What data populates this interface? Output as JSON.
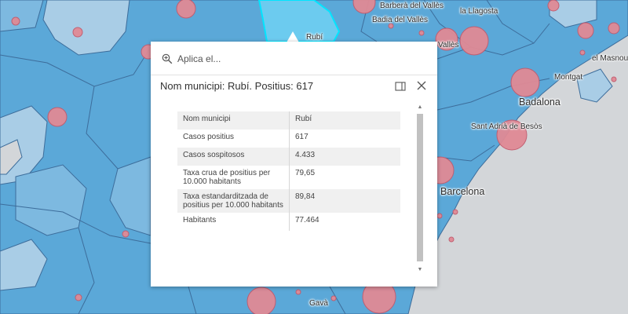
{
  "map": {
    "labels": [
      {
        "text": "Barberà del Vallès",
        "kind": "small"
      },
      {
        "text": "la Llagosta",
        "kind": "small"
      },
      {
        "text": "Badia del Vallès",
        "kind": "small"
      },
      {
        "text": "Rubí",
        "kind": "small"
      },
      {
        "text": "Vallès",
        "kind": "small"
      },
      {
        "text": "el Masnou",
        "kind": "small"
      },
      {
        "text": "Montgat",
        "kind": "small"
      },
      {
        "text": "Badalona",
        "kind": "big"
      },
      {
        "text": "Sant Adrià de Besòs",
        "kind": "small"
      },
      {
        "text": "Barcelona",
        "kind": "big"
      },
      {
        "text": "Gavà",
        "kind": "small"
      }
    ],
    "colors": {
      "water": "#d3d6d9",
      "region_dark": "#5ba8d8",
      "region_mid": "#7db9e0",
      "region_light": "#a9cde6",
      "selected_fill": "#6ccbef",
      "selected_outline": "#00e5ff",
      "boundary": "#3d6d9b",
      "bubble_fill": "#e08a95",
      "bubble_stroke": "#c25b6e"
    }
  },
  "popup": {
    "search_placeholder": "Aplica el...",
    "title": "Nom municipi: Rubí. Positius: 617",
    "rows": [
      {
        "key": "Nom municipi",
        "value": "Rubí"
      },
      {
        "key": "Casos positius",
        "value": "617"
      },
      {
        "key": "Casos sospitosos",
        "value": "4.433"
      },
      {
        "key": "Taxa crua de positius per 10.000 habitants",
        "value": "79,65"
      },
      {
        "key": "Taxa estandarditzada de positius per 10.000 habitants",
        "value": "89,84"
      },
      {
        "key": "Habitants",
        "value": "77.464"
      }
    ],
    "icons": {
      "search": "zoom-in-icon",
      "dock": "dock-icon",
      "close": "close-icon"
    }
  }
}
